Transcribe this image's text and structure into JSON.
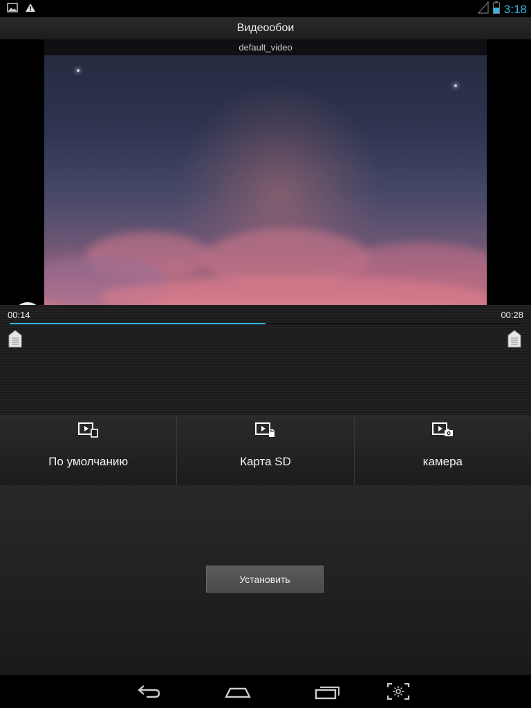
{
  "status_bar": {
    "time": "3:18",
    "icons": [
      "image-notification-icon",
      "warning-icon",
      "signal-icon",
      "battery-icon"
    ],
    "accent_color": "#33b5e5"
  },
  "title_bar": {
    "title": "Видеообои"
  },
  "video": {
    "file_name": "default_video",
    "state": "playing",
    "control_icon": "pause-icon"
  },
  "timeline": {
    "current_time": "00:14",
    "total_time": "00:28",
    "progress": 0.5
  },
  "sources": [
    {
      "label": "По умолчанию",
      "icon": "default-video-icon"
    },
    {
      "label": "Карта SD",
      "icon": "sd-card-video-icon"
    },
    {
      "label": "камера",
      "icon": "camera-video-icon"
    }
  ],
  "actions": {
    "set_label": "Установить"
  },
  "nav_bar": {
    "icons": [
      "back-icon",
      "home-icon",
      "recent-apps-icon",
      "screenshot-icon"
    ]
  }
}
